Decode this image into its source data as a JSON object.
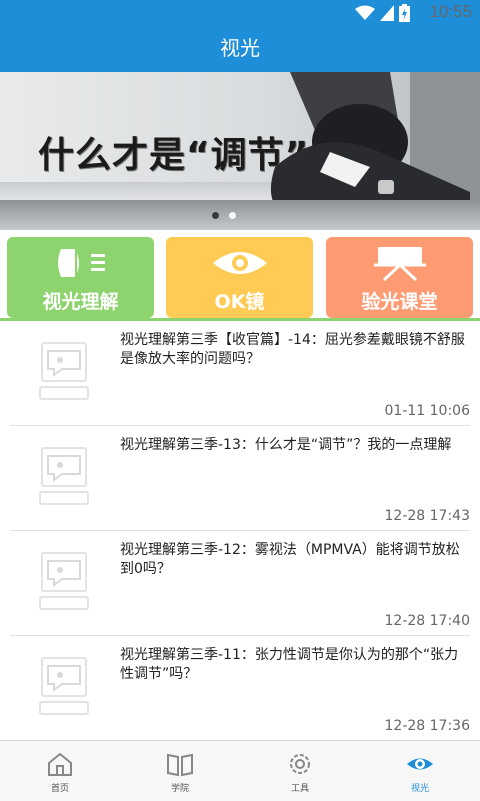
{
  "status_bar": {
    "time": "10:55"
  },
  "header": {
    "title": "视光"
  },
  "banner": {
    "headline": "什么才是“调节”",
    "slide_count": 2,
    "active_slide": 1
  },
  "quick_actions": [
    {
      "label": "视光理解",
      "icon": "lens-icon",
      "color": "#8dd46e"
    },
    {
      "label": "OK镜",
      "icon": "eye-icon",
      "color": "#ffcb55"
    },
    {
      "label": "验光课堂",
      "icon": "board-icon",
      "color": "#ff9b73"
    }
  ],
  "articles": [
    {
      "title": "视光理解第三季【收官篇】-14：屈光参差戴眼镜不舒服是像放大率的问题吗？",
      "time": "01-11 10:06"
    },
    {
      "title": "视光理解第三季-13：什么才是“调节”？我的一点理解",
      "time": "12-28 17:43"
    },
    {
      "title": "视光理解第三季-12：雾视法（MPMVA）能将调节放松到0吗？",
      "time": "12-28 17:40"
    },
    {
      "title": "视光理解第三季-11：张力性调节是你认为的那个“张力性调节”吗？",
      "time": "12-28 17:36"
    }
  ],
  "tabs": [
    {
      "label": "首页",
      "icon": "home-icon",
      "active": false
    },
    {
      "label": "学院",
      "icon": "book-icon",
      "active": false
    },
    {
      "label": "工具",
      "icon": "gear-icon",
      "active": false
    },
    {
      "label": "视光",
      "icon": "eye-icon",
      "active": true
    }
  ],
  "colors": {
    "primary": "#1e8ed8",
    "green": "#8dd46e",
    "yellow": "#ffcb55",
    "orange": "#ff9b73"
  }
}
